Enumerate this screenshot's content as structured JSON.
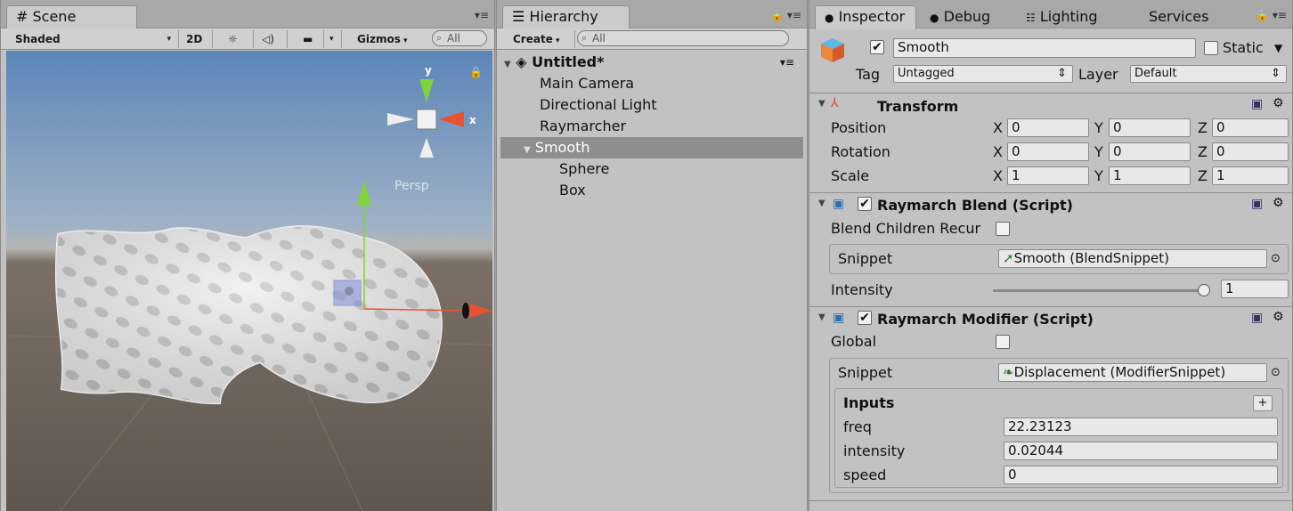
{
  "scene": {
    "tab_label": "Scene",
    "shading": "Shaded",
    "mode_2d": "2D",
    "gizmos": "Gizmos",
    "search_placeholder": "All",
    "axis_y": "y",
    "axis_x": "x",
    "persp": "Persp"
  },
  "hierarchy": {
    "tab_label": "Hierarchy",
    "create": "Create",
    "search_placeholder": "All",
    "root": "Untitled*",
    "items": [
      "Main Camera",
      "Directional Light",
      "Raymarcher",
      "Smooth",
      "Sphere",
      "Box"
    ]
  },
  "inspector": {
    "tabs": [
      "Inspector",
      "Debug",
      "Lighting",
      "Services"
    ],
    "object_name": "Smooth",
    "static_label": "Static",
    "tag_label": "Tag",
    "tag_value": "Untagged",
    "layer_label": "Layer",
    "layer_value": "Default",
    "transform": {
      "title": "Transform",
      "position_label": "Position",
      "rotation_label": "Rotation",
      "scale_label": "Scale",
      "position": [
        "0",
        "0",
        "0"
      ],
      "rotation": [
        "0",
        "0",
        "0"
      ],
      "scale": [
        "1",
        "1",
        "1"
      ],
      "x": "X",
      "y": "Y",
      "z": "Z"
    },
    "blend": {
      "title": "Raymarch Blend (Script)",
      "children_label": "Blend Children Recur",
      "snippet_label": "Snippet",
      "snippet_value": "Smooth (BlendSnippet)",
      "intensity_label": "Intensity",
      "intensity_value": "1",
      "intensity_level": 1.0
    },
    "modifier": {
      "title": "Raymarch Modifier (Script)",
      "global_label": "Global",
      "snippet_label": "Snippet",
      "snippet_value": "Displacement (ModifierSnippet)",
      "inputs_label": "Inputs",
      "add": "+",
      "inputs": [
        {
          "name": "freq",
          "value": "22.23123"
        },
        {
          "name": "intensity",
          "value": "0.02044"
        },
        {
          "name": "speed",
          "value": "0"
        }
      ]
    }
  }
}
